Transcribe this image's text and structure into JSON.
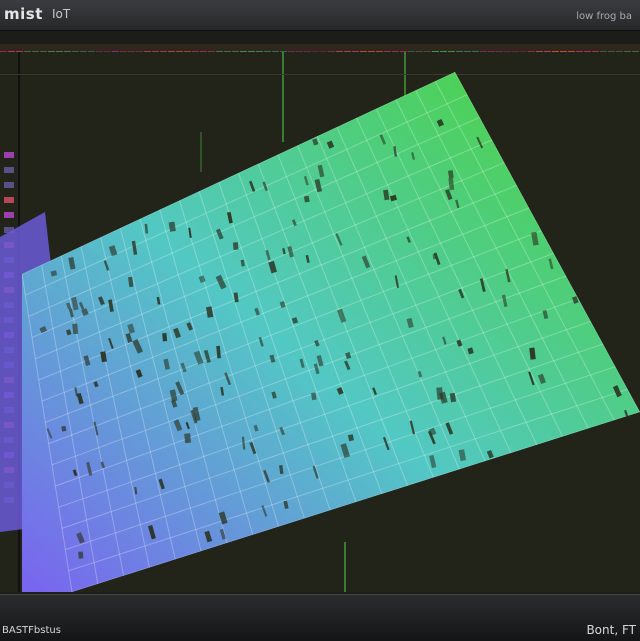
{
  "header": {
    "title": "mist",
    "subtitle": "IoT",
    "right_text": "low frog ba"
  },
  "status": {
    "left_text": "BASTFbstus",
    "right_text": "Bont, FT"
  },
  "colors": {
    "sheet_left": "#7a63f0",
    "sheet_mid": "#52c8c4",
    "sheet_right": "#4bd42f",
    "strip_accent_red": "#c63a56",
    "strip_accent_green": "#3fa34a"
  },
  "strip_palette": [
    "#c63a56",
    "#7a3040",
    "#3fa34a",
    "#d25b2d",
    "#8b2f6f",
    "#3b7d3e",
    "#b6474f",
    "#2f8c58"
  ],
  "grid": {
    "columns": 22,
    "rows": 15
  },
  "icons": {
    "window": "app-window-icon"
  }
}
